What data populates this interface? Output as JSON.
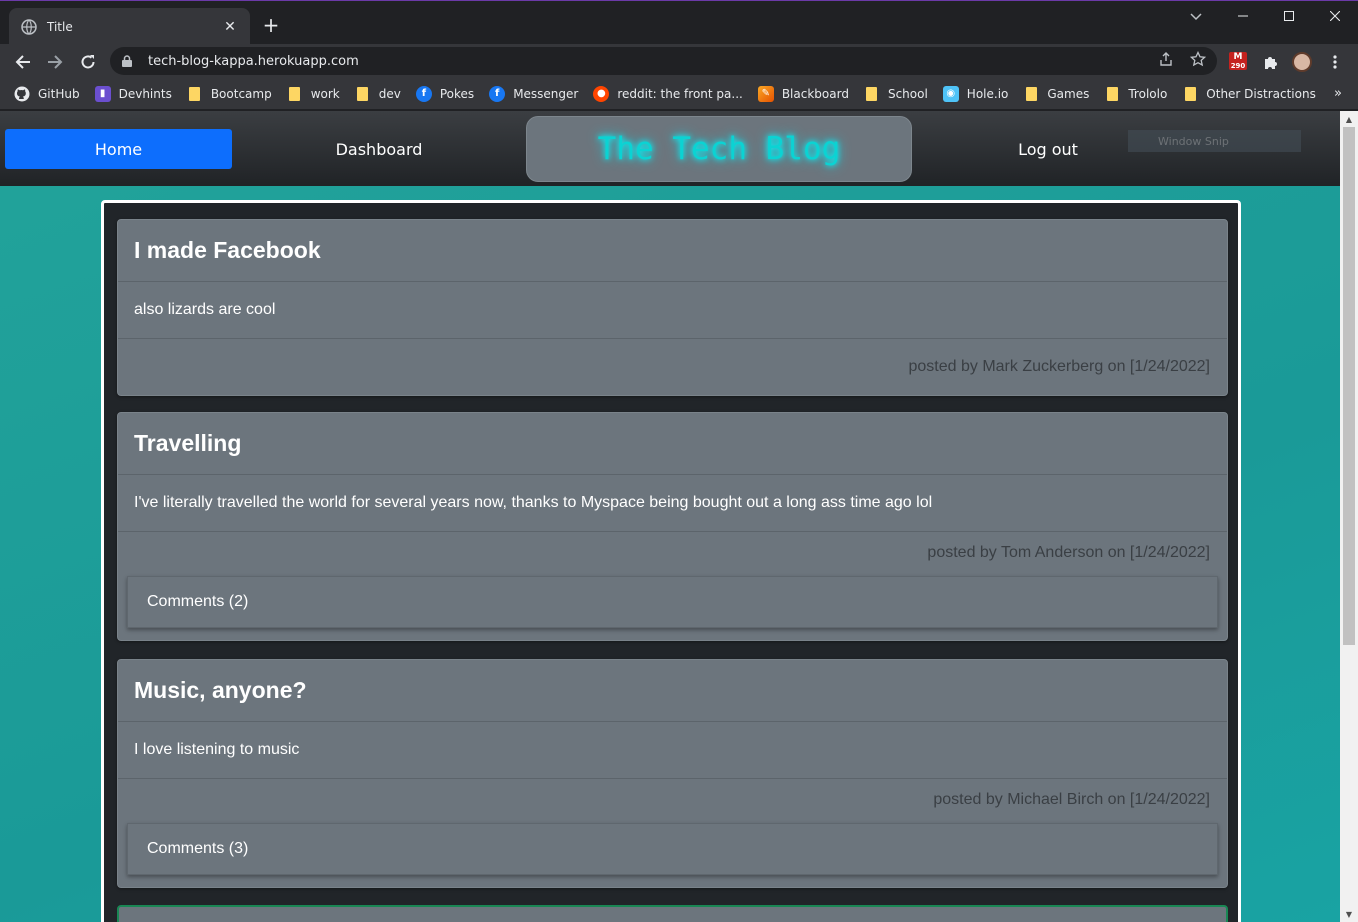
{
  "browser": {
    "tab_title": "Title",
    "url": "tech-blog-kappa.herokuapp.com",
    "gmail_count": "290",
    "bookmarks": [
      {
        "label": "GitHub",
        "icon": "github-icon"
      },
      {
        "label": "Devhints",
        "icon": "devhints-icon"
      },
      {
        "label": "Bootcamp",
        "icon": "folder-icon"
      },
      {
        "label": "work",
        "icon": "folder-icon"
      },
      {
        "label": "dev",
        "icon": "folder-icon"
      },
      {
        "label": "Pokes",
        "icon": "facebook-icon"
      },
      {
        "label": "Messenger",
        "icon": "facebook-icon"
      },
      {
        "label": "reddit: the front pa...",
        "icon": "reddit-icon"
      },
      {
        "label": "Blackboard",
        "icon": "blackboard-icon"
      },
      {
        "label": "School",
        "icon": "folder-icon"
      },
      {
        "label": "Hole.io",
        "icon": "holeio-icon"
      },
      {
        "label": "Games",
        "icon": "folder-icon"
      },
      {
        "label": "Trololo",
        "icon": "folder-icon"
      },
      {
        "label": "Other Distractions",
        "icon": "folder-icon"
      }
    ]
  },
  "nav": {
    "home": "Home",
    "dashboard": "Dashboard",
    "brand": "The Tech Blog",
    "logout": "Log out",
    "snip_overlay": "Window Snip"
  },
  "posts": [
    {
      "title": "I made Facebook",
      "body": "also lizards are cool",
      "footer": "posted by Mark Zuckerberg on [1/24/2022]",
      "comments": null
    },
    {
      "title": "Travelling",
      "body": "I've literally travelled the world for several years now, thanks to Myspace being bought out a long ass time ago lol",
      "footer": "posted by Tom Anderson on [1/24/2022]",
      "comments": "Comments (2)"
    },
    {
      "title": "Music, anyone?",
      "body": "I love listening to music",
      "footer": "posted by Michael Birch on [1/24/2022]",
      "comments": "Comments (3)"
    }
  ],
  "colors": {
    "accent": "#0d6efd",
    "brand_glow": "#00ffff",
    "page_bg": "#1a9a98",
    "card_bg": "#6c757d"
  }
}
